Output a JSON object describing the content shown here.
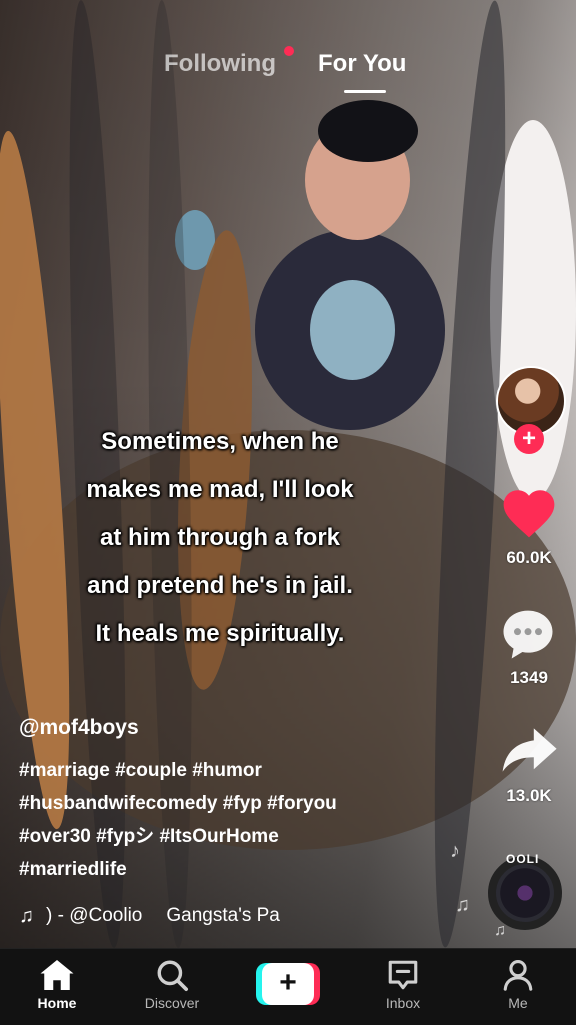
{
  "header": {
    "tabs": [
      {
        "label": "Following",
        "active": false,
        "has_notification_dot": true
      },
      {
        "label": "For You",
        "active": true
      }
    ]
  },
  "video": {
    "caption_lines": [
      "Sometimes, when he",
      "makes me mad, I'll look",
      "at him through a fork",
      "and pretend he's in jail.",
      "It heals me spiritually."
    ]
  },
  "sidebar": {
    "follow_button": "+",
    "likes": "60.0K",
    "comments": "1349",
    "shares": "13.0K",
    "disc_text": "OOLI"
  },
  "post": {
    "username": "@mof4boys",
    "hashtag_lines": [
      "#marriage #couple #humor",
      "#husbandwifecomedy #fyp #foryou",
      "#over30 #fypシ #ItsOurHome",
      "#marriedlife"
    ],
    "music_artist": ") - @Coolio",
    "music_title": "Gangsta's Pa"
  },
  "tabbar": {
    "items": [
      {
        "label": "Home",
        "icon": "home-icon",
        "active": true
      },
      {
        "label": "Discover",
        "icon": "search-icon",
        "active": false
      },
      {
        "label": "+",
        "icon": "create-icon",
        "active": false
      },
      {
        "label": "Inbox",
        "icon": "inbox-icon",
        "active": false
      },
      {
        "label": "Me",
        "icon": "profile-icon",
        "active": false
      }
    ]
  },
  "colors": {
    "accent_red": "#fe2c55",
    "accent_cyan": "#25f4ee",
    "tabbar_bg": "#121212"
  }
}
